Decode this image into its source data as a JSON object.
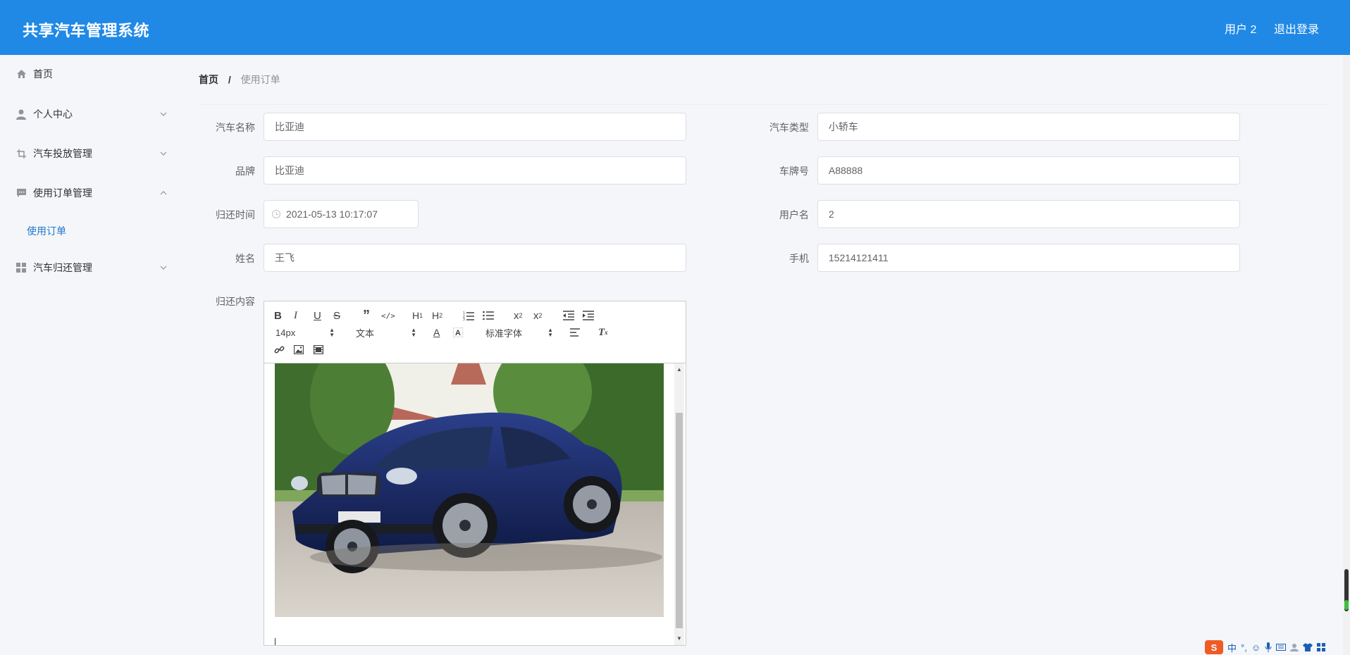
{
  "header": {
    "title": "共享汽车管理系统",
    "user": "用户 2",
    "logout": "退出登录"
  },
  "sidebar": {
    "items": [
      {
        "label": "首页",
        "icon": "home-icon"
      },
      {
        "label": "个人中心",
        "icon": "user-icon"
      },
      {
        "label": "汽车投放管理",
        "icon": "crop-icon"
      },
      {
        "label": "使用订单管理",
        "icon": "message-icon"
      },
      {
        "label": "汽车归还管理",
        "icon": "grid-icon"
      }
    ],
    "subitem": "使用订单"
  },
  "breadcrumb": {
    "home": "首页",
    "separator": "/",
    "current": "使用订单"
  },
  "form": {
    "car_name": {
      "label": "汽车名称",
      "value": "比亚迪"
    },
    "car_type": {
      "label": "汽车类型",
      "value": "小轿车"
    },
    "brand": {
      "label": "品牌",
      "value": "比亚迪"
    },
    "plate": {
      "label": "车牌号",
      "value": "A88888"
    },
    "return_time": {
      "label": "归还时间",
      "value": "2021-05-13 10:17:07"
    },
    "username": {
      "label": "用户名",
      "value": "2"
    },
    "name": {
      "label": "姓名",
      "value": "王飞"
    },
    "phone": {
      "label": "手机",
      "value": "15214121411"
    },
    "content": {
      "label": "归还内容"
    }
  },
  "editor": {
    "font_size": "14px",
    "header_select": "文本",
    "font_family": "标准字体"
  },
  "ime": {
    "logo": "S",
    "mode": "中"
  },
  "colors": {
    "header_bg": "#2089e6",
    "active_link": "#1f78d1"
  }
}
